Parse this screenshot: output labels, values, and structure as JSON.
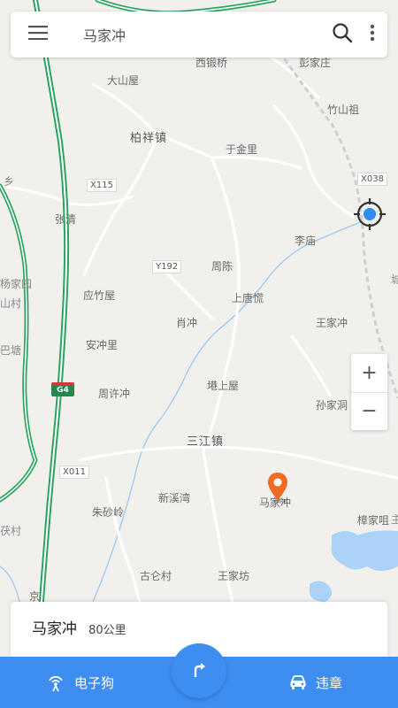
{
  "search": {
    "query": "马家冲"
  },
  "map": {
    "places": [
      {
        "id": "xiduanqiao",
        "label": "西锻桥"
      },
      {
        "id": "pengjiazhuang",
        "label": "彭家庄"
      },
      {
        "id": "dashanwu",
        "label": "大山屋"
      },
      {
        "id": "zhushanzu",
        "label": "竹山祖"
      },
      {
        "id": "baixiangzhen",
        "label": "柏祥镇"
      },
      {
        "id": "yujinli",
        "label": "于金里"
      },
      {
        "id": "xiang",
        "label": "乡"
      },
      {
        "id": "zhangqing",
        "label": "张清"
      },
      {
        "id": "limiao",
        "label": "李庙"
      },
      {
        "id": "yangjiayuan",
        "label": "杨家园"
      },
      {
        "id": "shancun",
        "label": "山村"
      },
      {
        "id": "zhouchen",
        "label": "周陈"
      },
      {
        "id": "yingzhuwu",
        "label": "应竹屋"
      },
      {
        "id": "shangtangqiao",
        "label": "上唐慌"
      },
      {
        "id": "xiaochong",
        "label": "肖冲"
      },
      {
        "id": "wangjiachong",
        "label": "王家冲"
      },
      {
        "id": "anchongli",
        "label": "安冲里"
      },
      {
        "id": "batang",
        "label": "巴塘"
      },
      {
        "id": "zhouxuchong",
        "label": "周许冲"
      },
      {
        "id": "kanshangwu",
        "label": "塂上屋"
      },
      {
        "id": "sunjiadong",
        "label": "孙家洞"
      },
      {
        "id": "sanjiangzhen",
        "label": "三江镇"
      },
      {
        "id": "xinxiwan",
        "label": "新溪湾"
      },
      {
        "id": "zhushaling",
        "label": "朱砂岭"
      },
      {
        "id": "majiachong",
        "label": "马家冲"
      },
      {
        "id": "zhangjiaju",
        "label": "樟家咀"
      },
      {
        "id": "fucun",
        "label": "茯村"
      },
      {
        "id": "gucangcun",
        "label": "古仑村"
      },
      {
        "id": "wangjiafang",
        "label": "王家坊"
      },
      {
        "id": "jing",
        "label": "京"
      },
      {
        "id": "cheng",
        "label": "城"
      },
      {
        "id": "zhu",
        "label": "主"
      }
    ],
    "road_tags": [
      {
        "id": "x115",
        "label": "X115"
      },
      {
        "id": "x038",
        "label": "X038"
      },
      {
        "id": "y192",
        "label": "Y192"
      },
      {
        "id": "x011",
        "label": "X011"
      }
    ],
    "highway_shield": "G4",
    "water_color": "#aad3f7",
    "road_color": "#ffffff",
    "highway_color": "#2aa561"
  },
  "controls": {
    "zoom_in": "+",
    "zoom_out": "−"
  },
  "result_card": {
    "name": "马家冲",
    "distance": "80公里"
  },
  "bottom_bar": {
    "left_label": "电子狗",
    "right_label": "违章",
    "accent": "#3d8ef0"
  }
}
